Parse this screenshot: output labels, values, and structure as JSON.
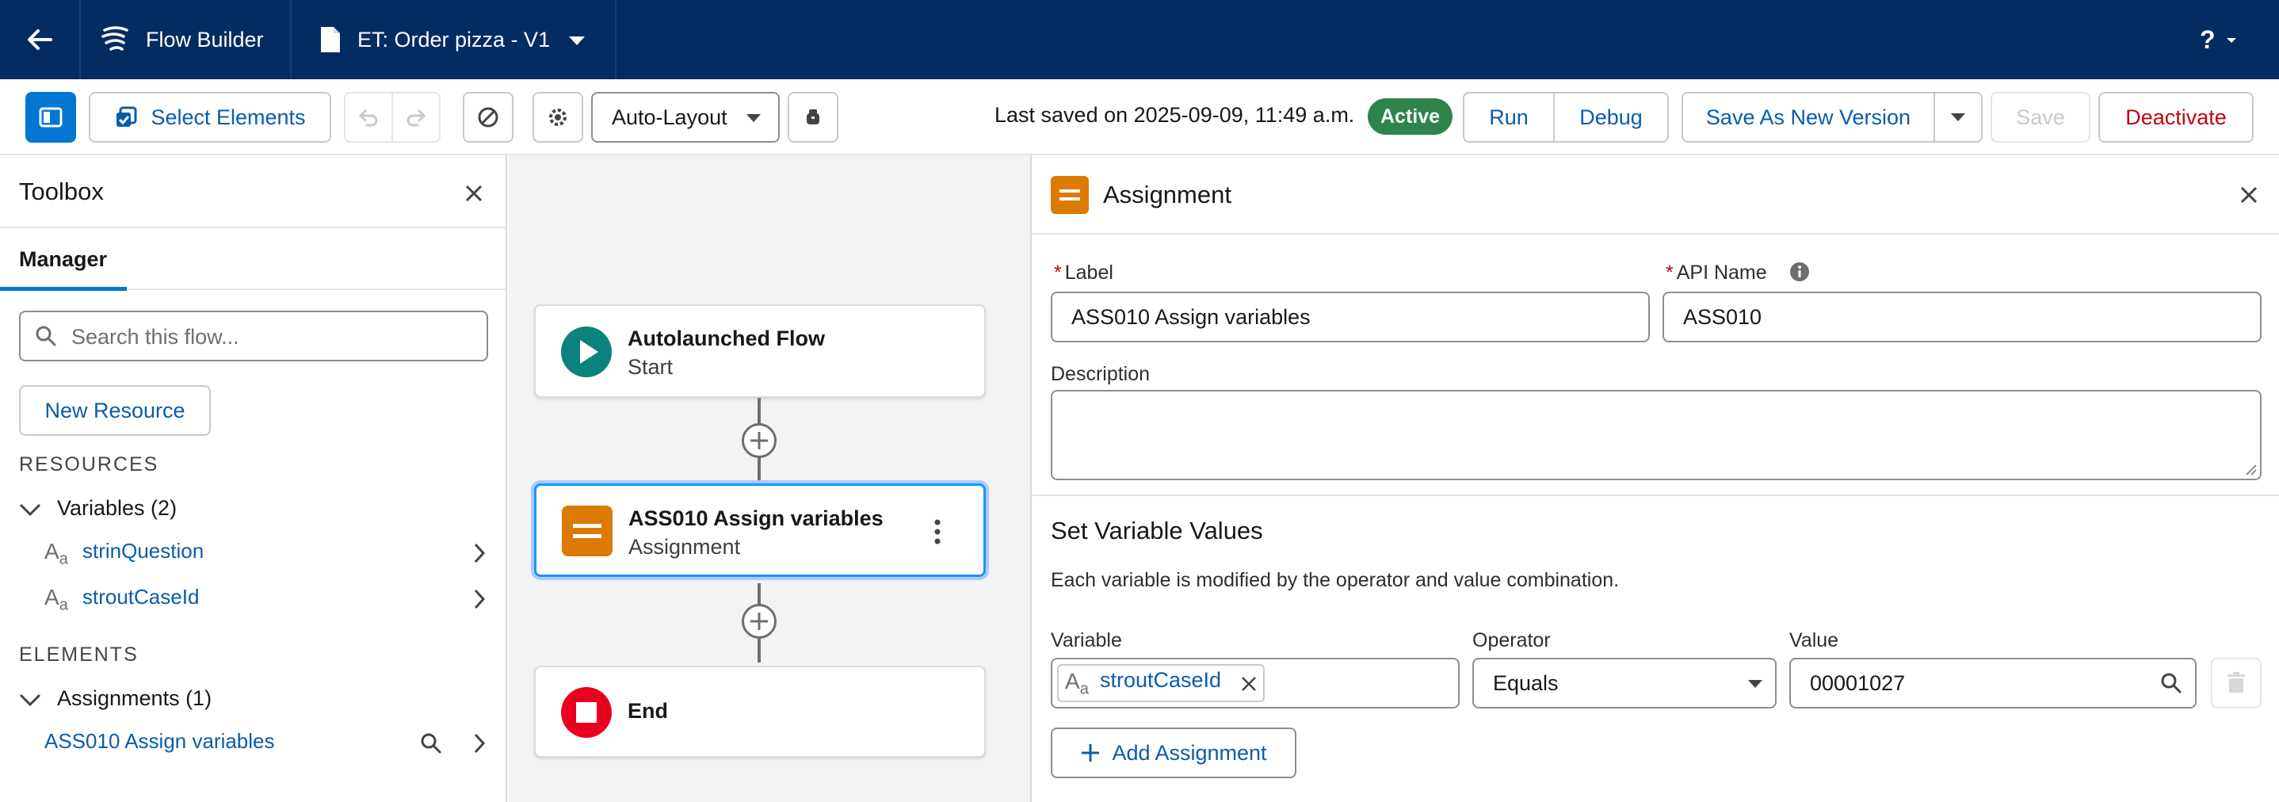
{
  "nav": {
    "app_name": "Flow Builder",
    "flow_title": "ET: Order pizza - V1",
    "help_label": "?"
  },
  "toolbar": {
    "select_elements_label": "Select Elements",
    "layout_mode": "Auto-Layout",
    "last_saved": "Last saved on 2025-09-09, 11:49 a.m.",
    "status_badge": "Active",
    "run_label": "Run",
    "debug_label": "Debug",
    "save_new_version_label": "Save As New Version",
    "save_label": "Save",
    "deactivate_label": "Deactivate"
  },
  "toolbox": {
    "title": "Toolbox",
    "tab_manager": "Manager",
    "search_placeholder": "Search this flow...",
    "new_resource_label": "New Resource",
    "resources_heading": "RESOURCES",
    "variables_group": "Variables (2)",
    "variables": [
      {
        "name": "strinQuestion",
        "type_icon": "text-type-icon"
      },
      {
        "name": "stroutCaseId",
        "type_icon": "text-type-icon"
      }
    ],
    "elements_heading": "ELEMENTS",
    "assignments_group": "Assignments (1)",
    "assignments": [
      {
        "name": "ASS010 Assign variables"
      }
    ]
  },
  "canvas": {
    "nodes": [
      {
        "title": "Autolaunched Flow",
        "subtitle": "Start",
        "icon": "play-icon",
        "color": "#0b827c"
      },
      {
        "title": "ASS010 Assign variables",
        "subtitle": "Assignment",
        "icon": "assignment-icon",
        "color": "#dd7a01"
      },
      {
        "title": "End",
        "subtitle": "",
        "icon": "stop-icon",
        "color": "#ea001e"
      }
    ]
  },
  "panel": {
    "title": "Assignment",
    "label_label": "Label",
    "label_value": "ASS010 Assign variables",
    "api_name_label": "API Name",
    "api_name_value": "ASS010",
    "description_label": "Description",
    "description_value": "",
    "set_values_heading": "Set Variable Values",
    "set_values_help": "Each variable is modified by the operator and value combination.",
    "variable_col": "Variable",
    "operator_col": "Operator",
    "value_col": "Value",
    "row": {
      "variable": "stroutCaseId",
      "operator": "Equals",
      "value": "00001027"
    },
    "add_assignment_label": "Add Assignment"
  },
  "colors": {
    "nav_bg": "#032d60",
    "brand": "#0176d3",
    "link": "#0b5cab",
    "active_badge": "#2e844a",
    "danger": "#ba0517"
  }
}
